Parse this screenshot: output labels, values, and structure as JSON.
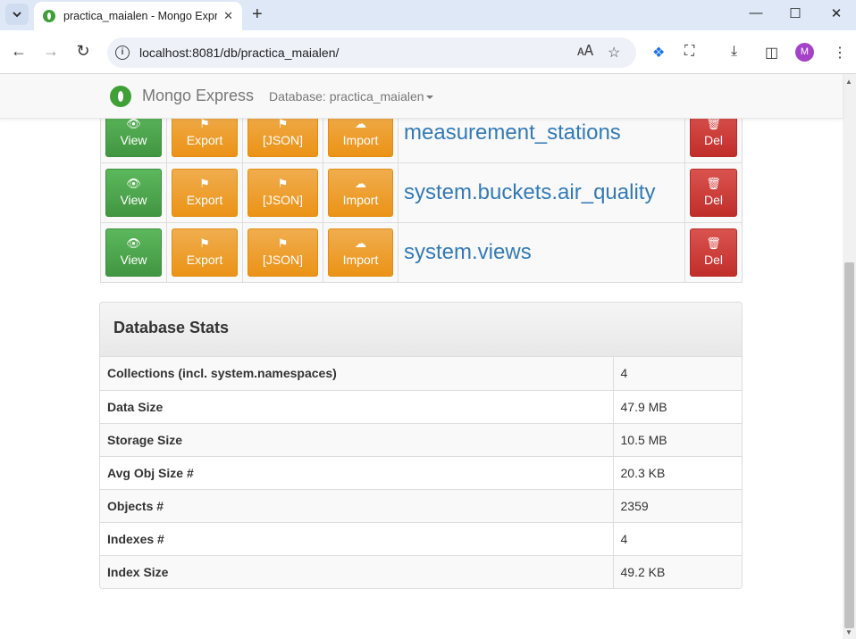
{
  "browser": {
    "tab_title": "practica_maialen - Mongo Expr",
    "url": "localhost:8081/db/practica_maialen/",
    "avatar_letter": "M",
    "new_tab_symbol": "+",
    "minimize_symbol": "—",
    "maximize_symbol": "☐",
    "close_symbol": "✕"
  },
  "app": {
    "brand": "Mongo Express",
    "database_menu": "Database: practica_maialen"
  },
  "collections": [
    {
      "name": "measurement_stations",
      "view": "View",
      "export": "Export",
      "json": "[JSON]",
      "import": "Import",
      "del": "Del"
    },
    {
      "name": "system.buckets.air_quality",
      "view": "View",
      "export": "Export",
      "json": "[JSON]",
      "import": "Import",
      "del": "Del"
    },
    {
      "name": "system.views",
      "view": "View",
      "export": "Export",
      "json": "[JSON]",
      "import": "Import",
      "del": "Del"
    }
  ],
  "stats": {
    "title": "Database Stats",
    "rows": [
      {
        "label": "Collections (incl. system.namespaces)",
        "value": "4"
      },
      {
        "label": "Data Size",
        "value": "47.9 MB"
      },
      {
        "label": "Storage Size",
        "value": "10.5 MB"
      },
      {
        "label": "Avg Obj Size #",
        "value": "20.3 KB"
      },
      {
        "label": "Objects #",
        "value": "2359"
      },
      {
        "label": "Indexes #",
        "value": "4"
      },
      {
        "label": "Index Size",
        "value": "49.2 KB"
      }
    ]
  },
  "colors": {
    "view": "#5cb85c",
    "orange": "#f0ad4e",
    "danger": "#d9534f",
    "link": "#337ab7",
    "brand": "#3fa037"
  },
  "icons": {
    "view": "eye-icon",
    "export": "export-icon",
    "json": "json-export-icon",
    "import": "cloud-upload-icon",
    "del": "trash-icon"
  }
}
